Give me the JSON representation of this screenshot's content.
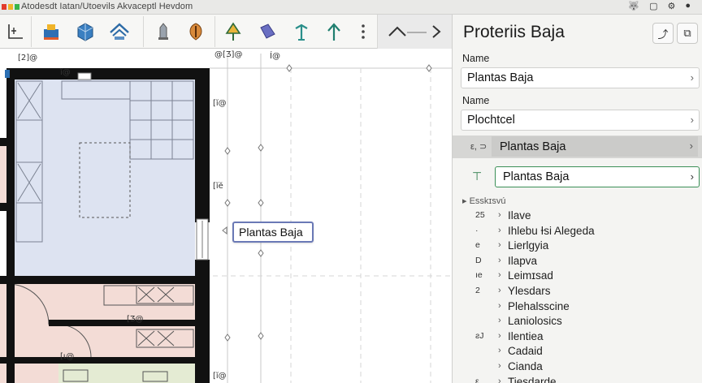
{
  "window": {
    "title": "Atodesdt Iatan/Utoevils Akvaceptl Hevdom",
    "dot_colors": [
      "#e23b2b",
      "#f0b429",
      "#39b54a"
    ],
    "icons": [
      "wolf-icon",
      "file-icon",
      "gear-icon",
      "dot-icon"
    ]
  },
  "toolbar": {
    "tools": [
      {
        "name": "room-tool-icon"
      },
      {
        "name": "building-blue-icon"
      },
      {
        "name": "cube-house-icon"
      },
      {
        "name": "roof-icon"
      },
      {
        "name": "tower-icon"
      },
      {
        "name": "shield-icon"
      },
      {
        "name": "tree-icon"
      },
      {
        "name": "rotate-icon"
      },
      {
        "name": "figure-icon"
      },
      {
        "name": "arrow-up-icon"
      },
      {
        "name": "more-vertical-icon"
      }
    ],
    "nav": {
      "up_icon": "chevron-up-icon",
      "right_icon": "chevron-right-icon"
    }
  },
  "canvas": {
    "labels": [
      {
        "id": "grid-label-1",
        "text": "[2]@"
      },
      {
        "id": "grid-label-2",
        "text": "@[Ʒ]@"
      },
      {
        "id": "grid-label-3",
        "text": "Í@"
      },
      {
        "id": "grid-label-4",
        "text": "[ĭ@"
      },
      {
        "id": "grid-label-5",
        "text": "[ĭĕ"
      },
      {
        "id": "grid-label-6",
        "text": "ĭ@"
      },
      {
        "id": "grid-label-7",
        "text": "[Ʒ@"
      },
      {
        "id": "grid-label-8",
        "text": "[ɩ@"
      },
      {
        "id": "grid-label-9",
        "text": "[ĭ@"
      }
    ],
    "callout": "Plantas Baja"
  },
  "panel": {
    "title": "Proteriis Baja",
    "head_buttons": [
      "export-icon",
      "copy-icon"
    ],
    "field1": {
      "label": "Name",
      "value": "Plantas Baja"
    },
    "field2": {
      "label": "Name",
      "value": "Plochtcel"
    },
    "selected_row": {
      "prefix": "ε, ⊃",
      "value": "Plantas Baja"
    },
    "active_row": {
      "prefix": "⊤",
      "value": "Plantas Baja"
    },
    "group": "▸  Esskɪsvú",
    "properties": [
      {
        "num": "25",
        "chev": "›",
        "text": "Ilave"
      },
      {
        "num": "·",
        "chev": "›",
        "text": "Ihlebu Ɨsi Alegeda"
      },
      {
        "num": "e",
        "chev": "›",
        "text": "Lierlgyia"
      },
      {
        "num": "D",
        "chev": "›",
        "text": "Ilapva"
      },
      {
        "num": "ıе",
        "chev": "›",
        "text": "Leimɪsad"
      },
      {
        "num": "2",
        "chev": "›",
        "text": "Ylesdars"
      },
      {
        "num": "",
        "chev": "›",
        "text": "Plehalsscine"
      },
      {
        "num": "",
        "chev": "›",
        "text": "Laniolosics"
      },
      {
        "num": "ƨJ",
        "chev": "›",
        "text": "Ilentiea"
      },
      {
        "num": "",
        "chev": "›",
        "text": "Cadaid"
      },
      {
        "num": "",
        "chev": "›",
        "text": "Cianda"
      },
      {
        "num": "ε",
        "chev": "›",
        "text": "Tiesdarde"
      }
    ]
  },
  "colors": {
    "wall": "#111111",
    "room_blue": "#dde3f1",
    "room_pink": "#f3dcd6",
    "room_green": "#e4ebd3",
    "accent_green": "#3b8f57",
    "callout_border": "#6a79b6"
  }
}
